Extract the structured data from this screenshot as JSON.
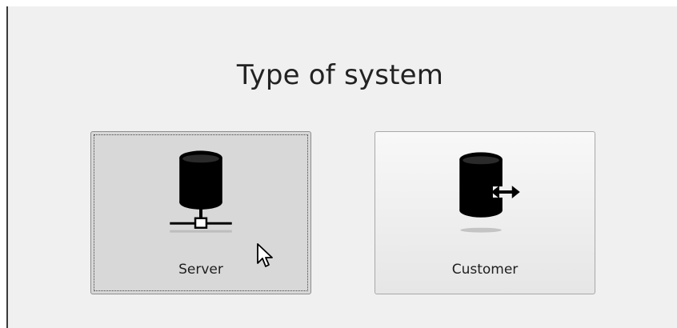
{
  "dialog": {
    "title": "Type of system",
    "options": [
      {
        "label": "Server",
        "icon": "database-server-icon",
        "state": "focused-hover"
      },
      {
        "label": "Customer",
        "icon": "database-exchange-icon",
        "state": "normal"
      }
    ]
  },
  "colors": {
    "panel_bg": "#f0f0f0",
    "icon": "#000000",
    "text": "#222222"
  }
}
